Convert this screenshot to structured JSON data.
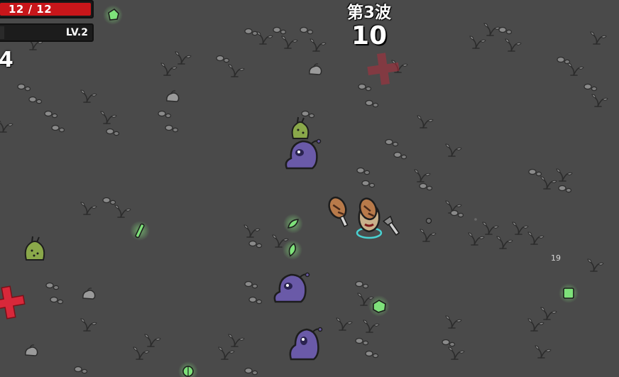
{
  "hud": {
    "hp_text": "12 / 12",
    "hp_fraction": 1.0,
    "level_text": "LV.2",
    "xp_fraction": 0.05,
    "materials_count": "4"
  },
  "wave": {
    "label": "第3波",
    "timer": "10"
  },
  "floating": {
    "damage_number": "19"
  },
  "colors": {
    "ground": "#4a4a4a",
    "hp_red": "#c8161a",
    "material_green": "#6ee06a",
    "alien_purple": "#6a5aa8",
    "spawn_cross": "#d8283a"
  }
}
